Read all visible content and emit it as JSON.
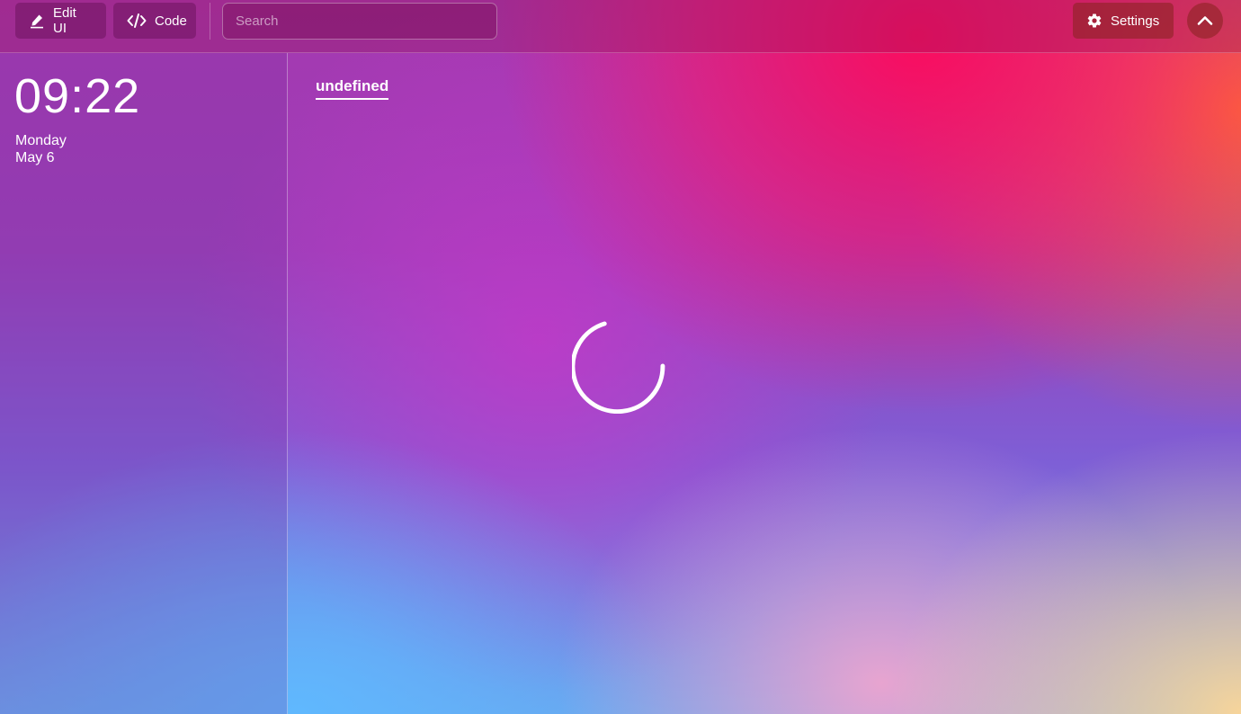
{
  "toolbar": {
    "edit_ui_label": "Edit UI",
    "code_label": "Code",
    "search_placeholder": "Search",
    "settings_label": "Settings"
  },
  "sidebar": {
    "time": "09:22",
    "day": "Monday",
    "date": "May 6"
  },
  "main": {
    "tab_label": "undefined",
    "status": "loading"
  },
  "icons": {
    "edit": "pencil-icon",
    "code": "code-icon",
    "settings": "gear-icon",
    "collapse": "chevron-up-icon",
    "loading": "spinner-icon"
  }
}
